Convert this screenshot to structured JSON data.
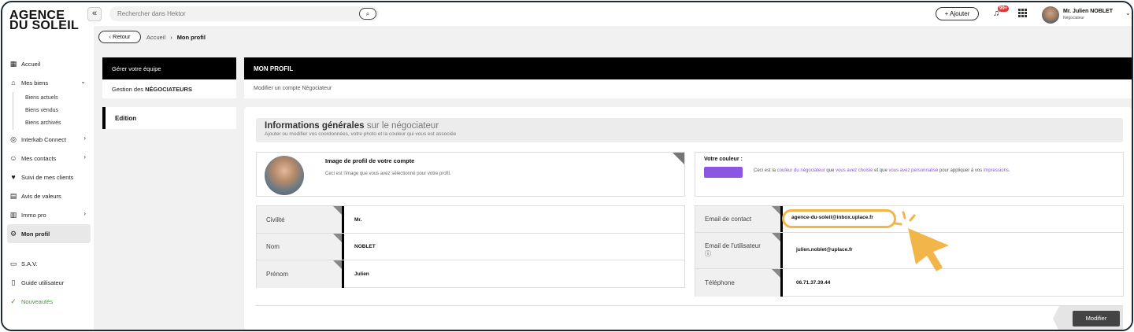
{
  "brand": {
    "line1": "AGENCE",
    "line2": "DU SOLEIL"
  },
  "sidebar": {
    "collapse": "«",
    "items": [
      {
        "label": "Accueil",
        "icon": "home-icon"
      },
      {
        "label": "Mes biens",
        "icon": "building-icon",
        "sub": [
          "Biens actuels",
          "Biens vendus",
          "Biens archivés"
        ]
      },
      {
        "label": "Interkab Connect",
        "icon": "link-icon"
      },
      {
        "label": "Mes contacts",
        "icon": "contacts-icon"
      },
      {
        "label": "Suivi de mes clients",
        "icon": "heart-icon"
      },
      {
        "label": "Avis de valeurs",
        "icon": "document-icon"
      },
      {
        "label": "Immo pro",
        "icon": "building-pro-icon"
      },
      {
        "label": "Mon profil",
        "icon": "gear-icon"
      },
      {
        "label": "S.A.V.",
        "icon": "chat-icon"
      },
      {
        "label": "Guide utilisateur",
        "icon": "book-icon"
      },
      {
        "label": "Nouveautés",
        "icon": "check-circle-icon"
      }
    ]
  },
  "topbar": {
    "search_placeholder": "Rechercher dans Hektor",
    "add_label": "+ Ajouter",
    "notif_count": "99+",
    "user_name": "Mr. Julien NOBLET",
    "user_role": "Négociateur"
  },
  "breadcrumb": {
    "back": "‹ Retour",
    "home": "Accueil",
    "current": "Mon profil"
  },
  "left_panel": {
    "header": "Gérer votre équipe",
    "row_prefix": "Gestion des ",
    "row_bold": "NÉGOCIATEURS",
    "edition": "Edition"
  },
  "main": {
    "header": "MON PROFIL",
    "subheader": "Modifier un compte Négociateur",
    "info_title_bold": "Informations générales",
    "info_title_light": " sur le négociateur",
    "info_desc": "Ajouter ou modifier vos coordonnées, votre photo et la couleur qui vous est associée",
    "photo_title": "Image de profil de votre compte",
    "photo_desc": "Ceci est l'image que vous avez sélectionné pour votre profil.",
    "color_label": "Votre couleur :",
    "color_hex": "#8a56e2",
    "color_desc_1": "Ceci est la ",
    "color_desc_link1": "couleur du négociateur",
    "color_desc_2": " que ",
    "color_desc_link2": "vous avez choisie",
    "color_desc_3": " et que ",
    "color_desc_link3": "vous avez personnalisé",
    "color_desc_4": " pour appliquer à vos ",
    "color_desc_link4": "impressions",
    "color_desc_5": ".",
    "fields_left": [
      {
        "label": "Civilité",
        "value": "Mr."
      },
      {
        "label": "Nom",
        "value": "NOBLET"
      },
      {
        "label": "Prénom",
        "value": "Julien"
      }
    ],
    "fields_right": [
      {
        "label": "Email de contact",
        "value": "agence-du-soleil@inbox.uplace.fr"
      },
      {
        "label": "Email de l'utilisateur",
        "value": "julien.noblet@uplace.fr"
      },
      {
        "label": "Téléphone",
        "value": "06.71.37.39.44"
      }
    ],
    "modify": "Modifier",
    "highlight_color": "#f2b54a"
  }
}
